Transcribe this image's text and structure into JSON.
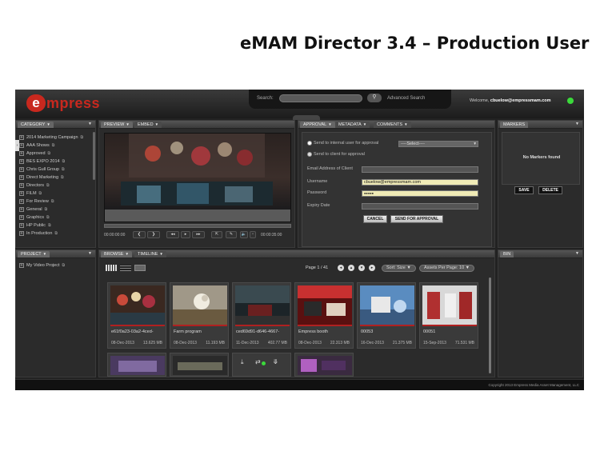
{
  "slide": {
    "title": "eMAM Director 3.4 – Production User"
  },
  "header": {
    "logo_first": "e",
    "logo_rest": "mpress",
    "search_label": "Search:",
    "search_icon": "search-icon",
    "advanced_search": "Advanced Search",
    "welcome_prefix": "Welcome,",
    "welcome_user": "cbuelow@empressmam.com",
    "status_color": "#3bd93b"
  },
  "category": {
    "tab": "CATEGORY",
    "items": [
      "2014 Marketing Campaign",
      "AAA Shows",
      "Approved",
      "BES EXPO 2014",
      "Chris Gull Group",
      "Direct Marketing",
      "Directors",
      "FILM",
      "For Review",
      "General",
      "Graphics",
      "HP Public",
      "In Production"
    ]
  },
  "project": {
    "tab": "PROJECT",
    "items": [
      "My Video Project"
    ]
  },
  "preview": {
    "tabs": [
      "PREVIEW",
      "EMBED"
    ],
    "time_start": "00:00:00:00",
    "time_end": "00:00:35:00"
  },
  "approval": {
    "tabs": [
      "APPROVAL",
      "METADATA",
      "COMMENTS"
    ],
    "radio_internal": "Send to internal user for approval",
    "radio_client": "Send to client for approval",
    "select_value": "----Select----",
    "email_label": "Email Address of Client",
    "username_label": "Username",
    "username_value": "cbuelow@empressmam.com",
    "password_label": "Password",
    "password_value": "●●●●●",
    "expiry_label": "Expiry Date",
    "cancel": "CANCEL",
    "send": "SEND FOR APPROVAL"
  },
  "markers": {
    "tab": "MARKERS",
    "empty": "No Markers found",
    "save": "SAVE",
    "delete": "DELETE"
  },
  "bin": {
    "tab": "BIN"
  },
  "browse": {
    "tabs": [
      "BROWSE",
      "TIMELINE"
    ],
    "page": "Page 1 / 41",
    "sort": "Sort: Size",
    "assets_per_page": "Assets Per Page: 10",
    "assets": [
      {
        "name": "e61f0a23-03a2-4ced-",
        "date": "08-Dec-2013",
        "size": "13.625 MB"
      },
      {
        "name": "Farm program",
        "date": "08-Dec-2013",
        "size": "11.193 MB"
      },
      {
        "name": "ced69d91-d646-4667-",
        "date": "11-Dec-2013",
        "size": "402.77 MB"
      },
      {
        "name": "Empress booth",
        "date": "08-Dec-2013",
        "size": "22.313 MB"
      },
      {
        "name": "00053",
        "date": "16-Dec-2013",
        "size": "21.375 MB"
      },
      {
        "name": "00051",
        "date": "15-Sep-2013",
        "size": "71.531 MB"
      }
    ]
  },
  "footer": {
    "copyright": "Copyright 2013 Empress Media Asset Management, LLC"
  }
}
